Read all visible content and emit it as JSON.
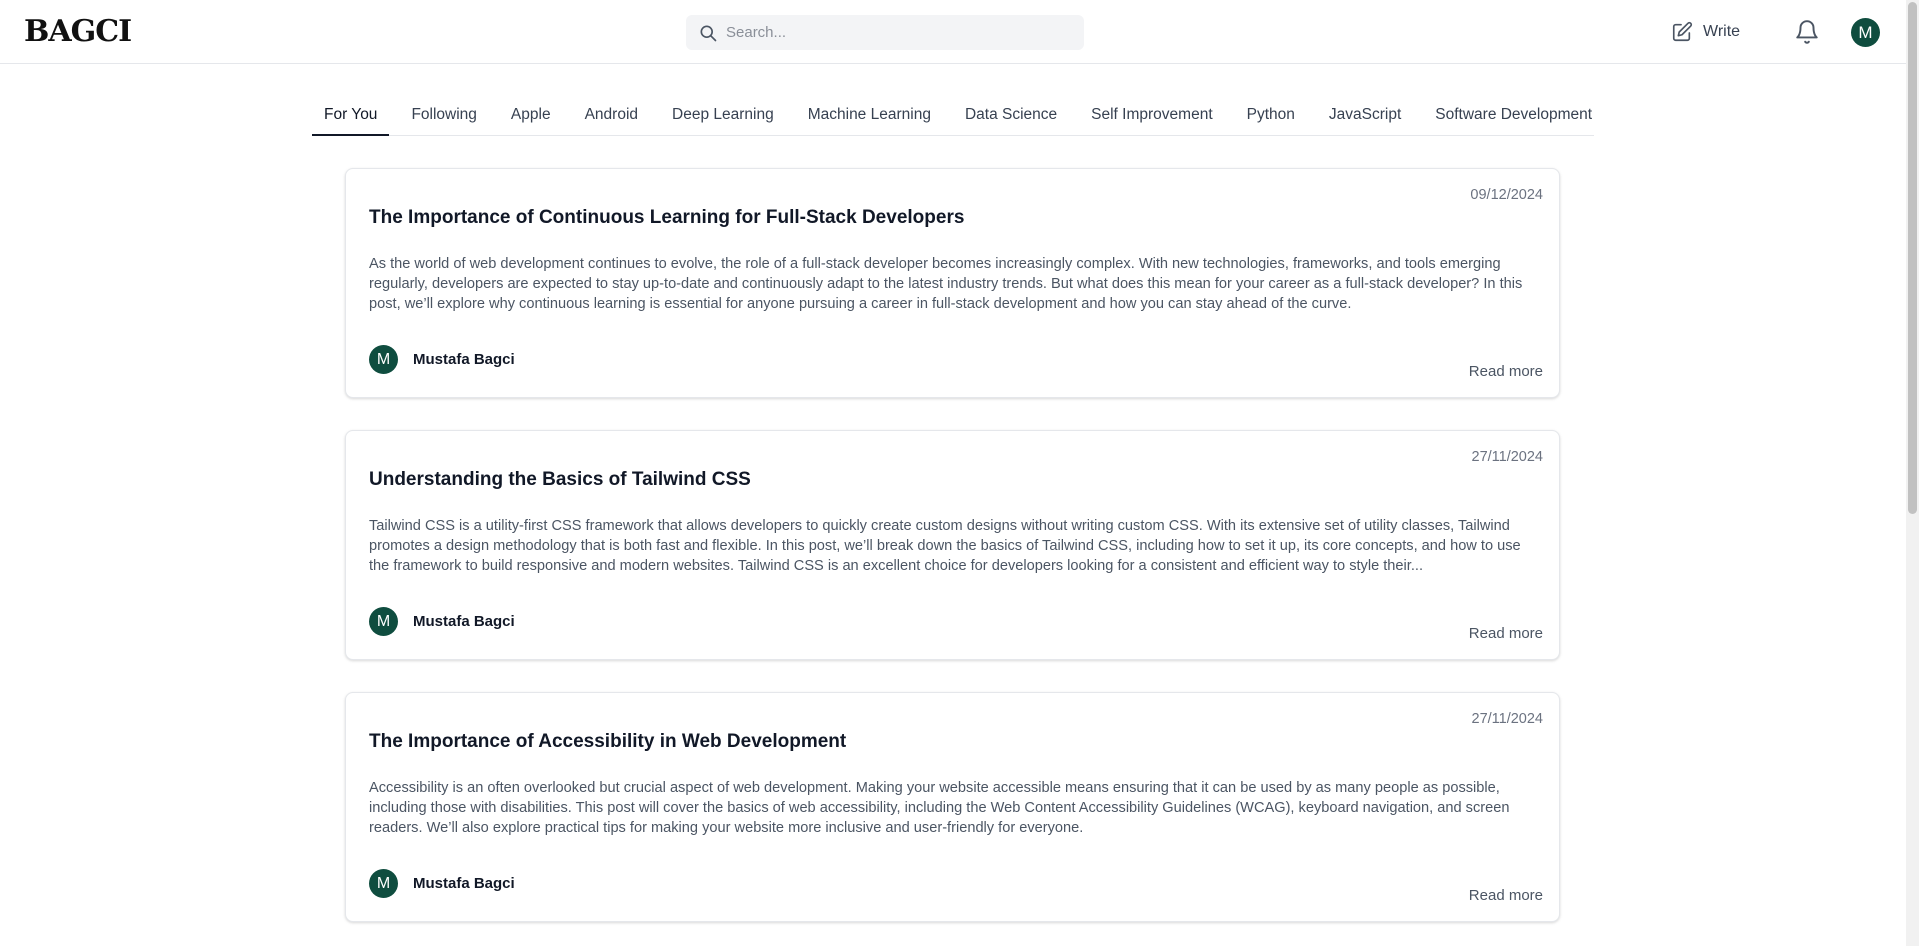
{
  "header": {
    "logo": "BAGCI",
    "search_placeholder": "Search...",
    "write_label": "Write",
    "avatar_initial": "M"
  },
  "tabs": [
    {
      "label": "For You",
      "active": true
    },
    {
      "label": "Following"
    },
    {
      "label": "Apple"
    },
    {
      "label": "Android"
    },
    {
      "label": "Deep Learning"
    },
    {
      "label": "Machine Learning"
    },
    {
      "label": "Data Science"
    },
    {
      "label": "Self Improvement"
    },
    {
      "label": "Python"
    },
    {
      "label": "JavaScript"
    },
    {
      "label": "Software Development"
    }
  ],
  "posts": [
    {
      "date": "09/12/2024",
      "title": "The Importance of Continuous Learning for Full-Stack Developers",
      "excerpt": "As the world of web development continues to evolve, the role of a full-stack developer becomes increasingly complex. With new technologies, frameworks, and tools emerging regularly, developers are expected to stay up-to-date and continuously adapt to the latest industry trends. But what does this mean for your career as a full-stack developer? In this post, we’ll explore why continuous learning is essential for anyone pursuing a career in full-stack development and how you can stay ahead of the curve.",
      "author_initial": "M",
      "author": "Mustafa Bagci",
      "read_more": "Read more"
    },
    {
      "date": "27/11/2024",
      "title": "Understanding the Basics of Tailwind CSS",
      "excerpt": "Tailwind CSS is a utility-first CSS framework that allows developers to quickly create custom designs without writing custom CSS. With its extensive set of utility classes, Tailwind promotes a design methodology that is both fast and flexible. In this post, we’ll break down the basics of Tailwind CSS, including how to set it up, its core concepts, and how to use the framework to build responsive and modern websites. Tailwind CSS is an excellent choice for developers looking for a consistent and efficient way to style their...",
      "author_initial": "M",
      "author": "Mustafa Bagci",
      "read_more": "Read more"
    },
    {
      "date": "27/11/2024",
      "title": "The Importance of Accessibility in Web Development",
      "excerpt": "Accessibility is an often overlooked but crucial aspect of web development. Making your website accessible means ensuring that it can be used by as many people as possible, including those with disabilities. This post will cover the basics of web accessibility, including the Web Content Accessibility Guidelines (WCAG), keyboard navigation, and screen readers. We’ll also explore practical tips for making your website more inclusive and user-friendly for everyone.",
      "author_initial": "M",
      "author": "Mustafa Bagci",
      "read_more": "Read more"
    }
  ],
  "colors": {
    "avatar_bg": "#0f4d3f",
    "active_tab": "#111827",
    "muted_text": "#6b7280"
  }
}
